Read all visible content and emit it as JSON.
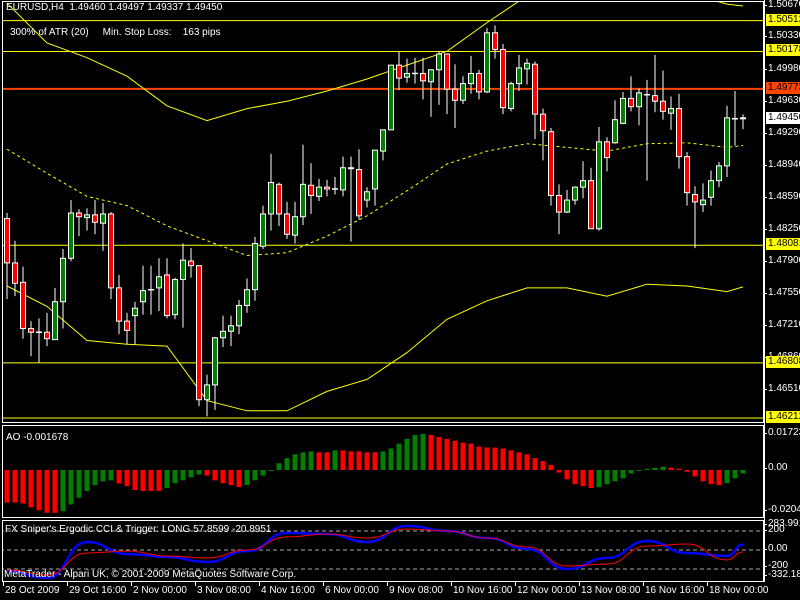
{
  "header": {
    "symbol": "EURUSD,H4",
    "ohlc": "1.49460 1.49497 1.49337 1.49450",
    "atr_text": "300% of ATR (20)",
    "stop_loss_label": "Min. Stop Loss:",
    "stop_loss_value": "163 pips"
  },
  "ao": {
    "label": "AO -0.001678"
  },
  "cci": {
    "label": "FX Sniper's Ergodic CCI & Trigger: LONG 57.8599 -20.8951"
  },
  "footer": {
    "copyright": "MetaTrader - Alpari UK, © 2001-2009 MetaQuotes Software Corp."
  },
  "colors": {
    "bull": "#008000",
    "bear": "#ff0000",
    "band": "#ffff00",
    "level": "#ffff00",
    "resistance": "#ff4500",
    "cci_main": "#0000ff",
    "cci_signal": "#ff0000"
  },
  "chart_data": [
    {
      "type": "candlestick",
      "title": "EURUSD,H4",
      "ylim": [
        1.46147,
        1.50724
      ],
      "price_ticks": [
        "1.50670",
        "1.50330",
        "1.49980",
        "1.49630",
        "1.49290",
        "1.48940",
        "1.48590",
        "1.48250",
        "1.47900",
        "1.47550",
        "1.47210",
        "1.46860",
        "1.46510"
      ],
      "levels": [
        {
          "value": "1.50512",
          "style": "yellow"
        },
        {
          "value": "1.50178",
          "style": "yellow"
        },
        {
          "value": "1.49773",
          "style": "orange"
        },
        {
          "value": "1.48081",
          "style": "yellow"
        },
        {
          "value": "1.46808",
          "style": "yellow"
        },
        {
          "value": "1.46212",
          "style": "yellow"
        }
      ],
      "current_price": "1.49450",
      "time_labels": [
        "28 Oct 2009",
        "29 Oct 16:00",
        "2 Nov 00:00",
        "3 Nov 08:00",
        "4 Nov 16:00",
        "6 Nov 00:00",
        "9 Nov 08:00",
        "10 Nov 16:00",
        "12 Nov 00:00",
        "13 Nov 08:00",
        "16 Nov 16:00",
        "18 Nov 00:00"
      ],
      "time_label_every": 8,
      "ohlc": [
        [
          1.4837,
          1.4843,
          1.475,
          1.4789
        ],
        [
          1.4789,
          1.4813,
          1.4753,
          1.4767
        ],
        [
          1.4768,
          1.4785,
          1.4707,
          1.4718
        ],
        [
          1.4718,
          1.4726,
          1.4688,
          1.4714
        ],
        [
          1.4714,
          1.4729,
          1.4681,
          1.4714
        ],
        [
          1.4714,
          1.4735,
          1.4699,
          1.4707
        ],
        [
          1.4706,
          1.4762,
          1.4706,
          1.4747
        ],
        [
          1.4747,
          1.4804,
          1.4718,
          1.4794
        ],
        [
          1.4794,
          1.4857,
          1.4791,
          1.4843
        ],
        [
          1.4843,
          1.4847,
          1.4818,
          1.4839
        ],
        [
          1.4838,
          1.4848,
          1.4824,
          1.4841
        ],
        [
          1.4841,
          1.4857,
          1.482,
          1.4833
        ],
        [
          1.4832,
          1.4854,
          1.4802,
          1.4842
        ],
        [
          1.4842,
          1.4844,
          1.475,
          1.4762
        ],
        [
          1.4762,
          1.4776,
          1.4712,
          1.4726
        ],
        [
          1.4726,
          1.4735,
          1.4701,
          1.4716
        ],
        [
          1.4732,
          1.4747,
          1.4701,
          1.474
        ],
        [
          1.4747,
          1.4786,
          1.4733,
          1.4759
        ],
        [
          1.476,
          1.4786,
          1.4733,
          1.476
        ],
        [
          1.4762,
          1.4794,
          1.4737,
          1.4774
        ],
        [
          1.4776,
          1.4794,
          1.4729,
          1.4732
        ],
        [
          1.4733,
          1.4773,
          1.4728,
          1.4771
        ],
        [
          1.4771,
          1.481,
          1.4719,
          1.4792
        ],
        [
          1.4791,
          1.4805,
          1.4773,
          1.4786
        ],
        [
          1.4786,
          1.4786,
          1.4634,
          1.4641
        ],
        [
          1.4641,
          1.4668,
          1.4623,
          1.4657
        ],
        [
          1.4657,
          1.4709,
          1.463,
          1.4708
        ],
        [
          1.4708,
          1.4732,
          1.4698,
          1.4715
        ],
        [
          1.4715,
          1.4732,
          1.4699,
          1.4721
        ],
        [
          1.4721,
          1.4749,
          1.4712,
          1.4743
        ],
        [
          1.4743,
          1.4772,
          1.4735,
          1.476
        ],
        [
          1.476,
          1.4817,
          1.4748,
          1.481
        ],
        [
          1.4807,
          1.4851,
          1.4804,
          1.4842
        ],
        [
          1.4842,
          1.4907,
          1.4824,
          1.4876
        ],
        [
          1.4874,
          1.4876,
          1.4829,
          1.4842
        ],
        [
          1.4842,
          1.4855,
          1.4815,
          1.482
        ],
        [
          1.4819,
          1.4855,
          1.481,
          1.4839
        ],
        [
          1.4839,
          1.4917,
          1.483,
          1.4874
        ],
        [
          1.4873,
          1.4897,
          1.4842,
          1.4862
        ],
        [
          1.4861,
          1.488,
          1.4856,
          1.4871
        ],
        [
          1.4871,
          1.4879,
          1.4861,
          1.4869
        ],
        [
          1.4869,
          1.4882,
          1.4863,
          1.4869
        ],
        [
          1.4868,
          1.4904,
          1.4861,
          1.4892
        ],
        [
          1.4892,
          1.4904,
          1.4812,
          1.4891
        ],
        [
          1.489,
          1.4912,
          1.4836,
          1.484
        ],
        [
          1.4857,
          1.4871,
          1.4849,
          1.4866
        ],
        [
          1.4869,
          1.4911,
          1.4851,
          1.4911
        ],
        [
          1.491,
          1.4933,
          1.49,
          1.4933
        ],
        [
          1.4933,
          1.5003,
          1.4933,
          1.5003
        ],
        [
          1.5003,
          1.5018,
          1.4976,
          1.4989
        ],
        [
          1.499,
          1.501,
          1.4984,
          1.4994
        ],
        [
          1.4994,
          1.5011,
          1.4983,
          1.4994
        ],
        [
          1.4994,
          1.5011,
          1.4966,
          1.4986
        ],
        [
          1.4985,
          1.4998,
          1.4947,
          1.4998
        ],
        [
          1.4998,
          1.5018,
          1.496,
          1.5015
        ],
        [
          1.5015,
          1.5015,
          1.495,
          1.4977
        ],
        [
          1.4977,
          1.5004,
          1.4935,
          1.4965
        ],
        [
          1.4965,
          1.4991,
          1.4961,
          1.4983
        ],
        [
          1.4983,
          1.5013,
          1.4972,
          1.4994
        ],
        [
          1.4994,
          1.4998,
          1.4966,
          1.4974
        ],
        [
          1.4974,
          1.5043,
          1.4973,
          1.5038
        ],
        [
          1.5038,
          1.5046,
          1.501,
          1.502
        ],
        [
          1.502,
          1.5026,
          1.495,
          1.4957
        ],
        [
          1.4956,
          1.4985,
          1.4953,
          1.4983
        ],
        [
          1.4983,
          1.5014,
          1.4975,
          1.5
        ],
        [
          1.4999,
          1.501,
          1.4982,
          1.5005
        ],
        [
          1.5004,
          1.5007,
          1.4923,
          1.495
        ],
        [
          1.495,
          1.4956,
          1.49,
          1.4932
        ],
        [
          1.4931,
          1.4935,
          1.4851,
          1.4862
        ],
        [
          1.4862,
          1.4874,
          1.482,
          1.4844
        ],
        [
          1.4844,
          1.4868,
          1.4843,
          1.4857
        ],
        [
          1.4857,
          1.4872,
          1.4852,
          1.4871
        ],
        [
          1.4871,
          1.4899,
          1.4859,
          1.4878
        ],
        [
          1.4878,
          1.4892,
          1.4826,
          1.4826
        ],
        [
          1.4826,
          1.4936,
          1.4824,
          1.492
        ],
        [
          1.492,
          1.4925,
          1.4888,
          1.4903
        ],
        [
          1.4919,
          1.4965,
          1.4918,
          1.4944
        ],
        [
          1.494,
          1.4974,
          1.4939,
          1.4967
        ],
        [
          1.4967,
          1.4991,
          1.4953,
          1.4958
        ],
        [
          1.4958,
          1.4978,
          1.4938,
          1.4973
        ],
        [
          1.4971,
          1.4987,
          1.4878,
          1.4971
        ],
        [
          1.497,
          1.5014,
          1.4952,
          1.4964
        ],
        [
          1.4964,
          1.4997,
          1.4944,
          1.4953
        ],
        [
          1.4951,
          1.4969,
          1.4933,
          1.4956
        ],
        [
          1.4956,
          1.4972,
          1.4891,
          1.4904
        ],
        [
          1.4904,
          1.4909,
          1.4851,
          1.4865
        ],
        [
          1.4863,
          1.4872,
          1.4805,
          1.4855
        ],
        [
          1.4852,
          1.4875,
          1.4844,
          1.4857
        ],
        [
          1.486,
          1.4889,
          1.4851,
          1.4878
        ],
        [
          1.4878,
          1.4898,
          1.4871,
          1.4894
        ],
        [
          1.4894,
          1.4959,
          1.4882,
          1.4946
        ],
        [
          1.4945,
          1.4975,
          1.4916,
          1.4945
        ],
        [
          1.4946,
          1.49497,
          1.49337,
          1.4945
        ]
      ],
      "bands_sample_every": 5,
      "bands": {
        "upper": [
          1.507,
          1.5027,
          1.5011,
          1.4991,
          1.4959,
          1.4943,
          1.4956,
          1.4964,
          1.4975,
          1.4988,
          1.5003,
          1.5018,
          1.5049,
          1.5078,
          1.5089,
          1.5094,
          1.5089,
          1.5081,
          1.5069,
          1.5067
        ],
        "middle": [
          1.4912,
          1.4886,
          1.4861,
          1.4851,
          1.4829,
          1.4813,
          1.4797,
          1.48,
          1.4818,
          1.484,
          1.4867,
          1.4896,
          1.491,
          1.4918,
          1.4914,
          1.491,
          1.4918,
          1.4919,
          1.4914,
          1.4916
        ],
        "lower": [
          1.4764,
          1.4742,
          1.4705,
          1.4701,
          1.4699,
          1.464,
          1.4629,
          1.4629,
          1.465,
          1.4663,
          1.4692,
          1.4728,
          1.4748,
          1.4762,
          1.4762,
          1.4753,
          1.4766,
          1.4764,
          1.4758,
          1.4763
        ]
      }
    },
    {
      "type": "bar",
      "title": "AO",
      "ylim": [
        -0.02049,
        0.017234
      ],
      "tick_labels": [
        "0.017234",
        "0.00",
        "-0.02049"
      ],
      "values": [
        -0.01557,
        -0.01557,
        -0.01603,
        -0.01788,
        -0.01927,
        -0.02049,
        -0.02049,
        -0.01973,
        -0.01649,
        -0.01326,
        -0.01003,
        -0.00725,
        -0.00541,
        -0.00494,
        -0.00647,
        -0.00772,
        -0.00956,
        -0.01003,
        -0.01003,
        -0.01003,
        -0.00864,
        -0.00633,
        -0.00494,
        -0.00356,
        -0.00217,
        -0.00263,
        -0.00494,
        -0.00633,
        -0.00725,
        -0.00818,
        -0.00725,
        -0.00494,
        -0.00263,
        -0.00032,
        0.00323,
        0.00568,
        0.00753,
        0.00845,
        0.00892,
        0.00845,
        0.00845,
        0.00938,
        0.00938,
        0.00892,
        0.00892,
        0.00845,
        0.00845,
        0.00892,
        0.0103,
        0.01261,
        0.01492,
        0.01677,
        0.01723,
        0.01677,
        0.01585,
        0.01492,
        0.014,
        0.01307,
        0.01261,
        0.01123,
        0.01076,
        0.01076,
        0.0103,
        0.00938,
        0.00845,
        0.00753,
        0.00568,
        0.0043,
        0.00245,
        -0.00125,
        -0.00448,
        -0.00679,
        -0.00772,
        -0.00864,
        -0.00818,
        -0.00679,
        -0.00541,
        -0.00402,
        -0.00171,
        -0.00032,
        0.0006,
        0.00106,
        0.00152,
        0.00106,
        0.0006,
        -0.00079,
        -0.0031,
        -0.00541,
        -0.00679,
        -0.00725,
        -0.00633,
        -0.00402,
        -0.001678
      ]
    },
    {
      "type": "line",
      "title": "FX Sniper's Ergodic CCI & Trigger",
      "ylim": [
        -332.188,
        283.9916
      ],
      "tick_labels": [
        "283.9916",
        "200",
        "0.00",
        "-200",
        "-332.188"
      ],
      "levels": [
        200,
        0,
        -200
      ],
      "sample_every": 5,
      "series": [
        {
          "name": "Ergodic CCI",
          "values": [
            -221,
            -295,
            84,
            -42,
            -74,
            -126,
            -11,
            179,
            168,
            84,
            253,
            200,
            126,
            11,
            -200,
            -84,
            95,
            -32,
            -63,
            57.8599
          ]
        },
        {
          "name": "Trigger",
          "values": [
            -211,
            -263,
            -32,
            -11,
            -63,
            -84,
            0,
            137,
            168,
            126,
            221,
            200,
            126,
            32,
            -168,
            -147,
            42,
            63,
            -105,
            -20.8951
          ]
        }
      ]
    }
  ]
}
